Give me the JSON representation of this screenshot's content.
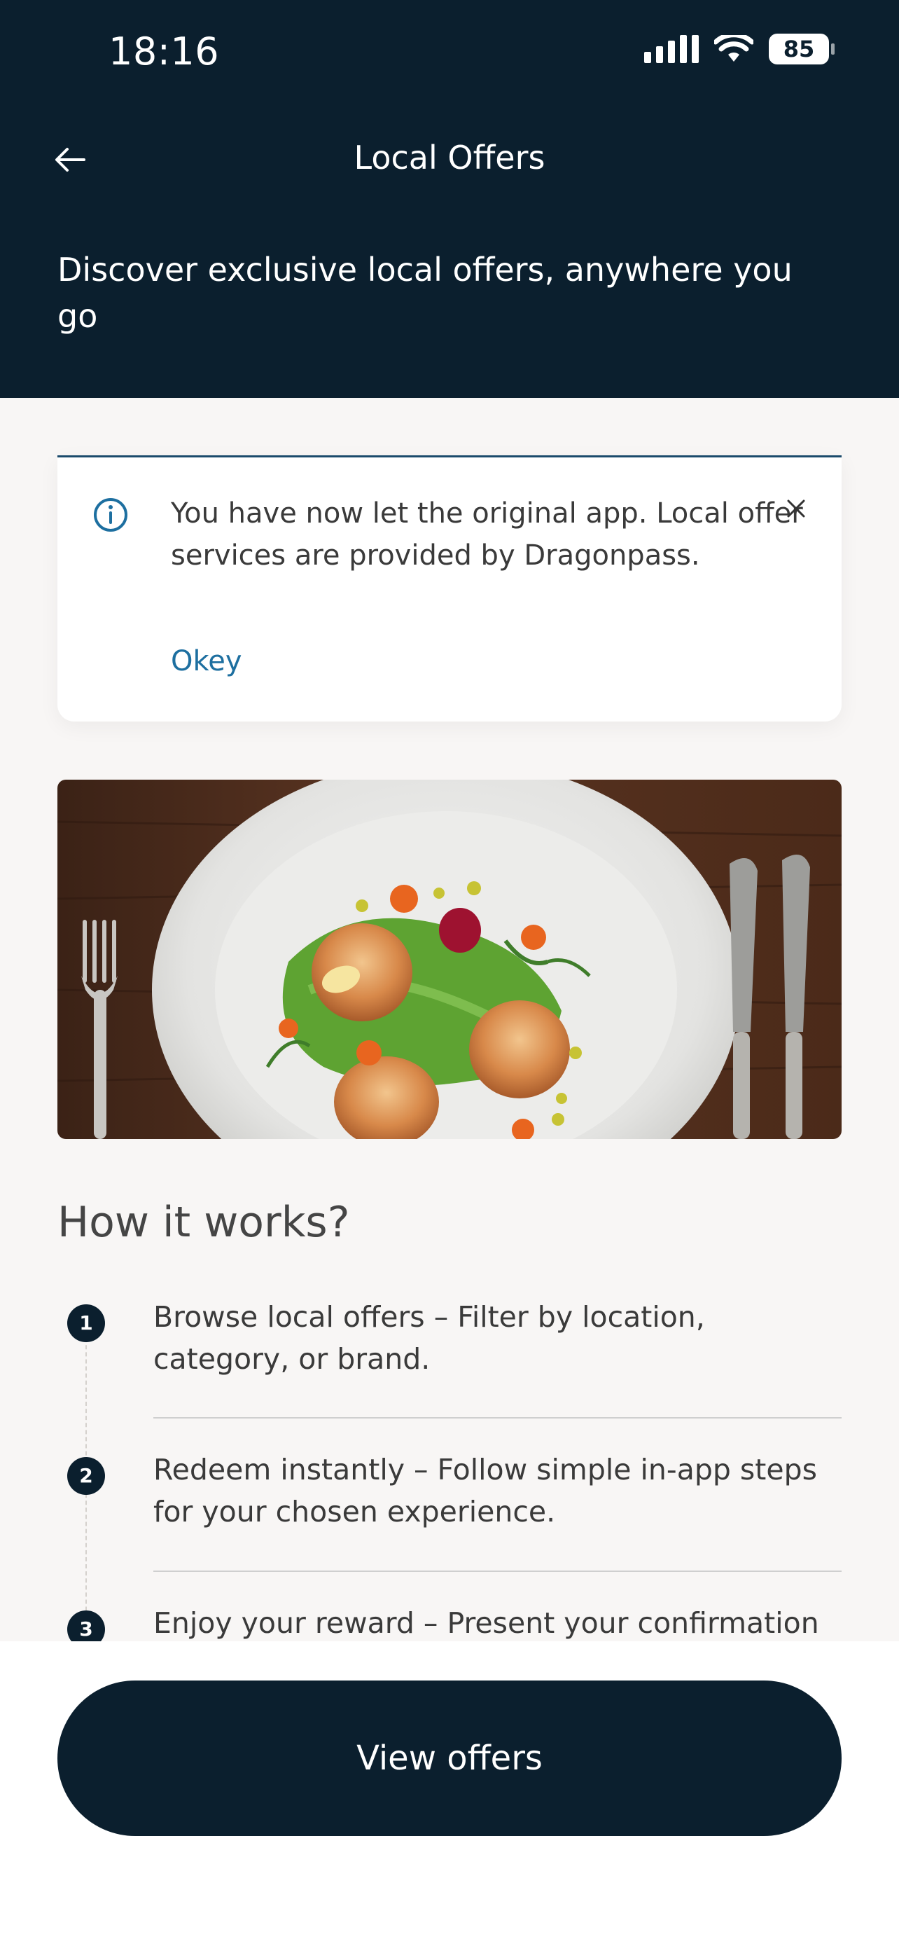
{
  "status_bar": {
    "time": "18:16",
    "battery": "85"
  },
  "header": {
    "title": "Local Offers",
    "subtitle": "Discover exclusive local offers, anywhere you go"
  },
  "notice": {
    "message": "You have now let the original app. Local offer services are provided by Dragonpass.",
    "action_label": "Okey"
  },
  "how_it_works": {
    "title": "How it works?",
    "steps": [
      {
        "number": "1",
        "text": "Browse local offers – Filter by location, category, or brand."
      },
      {
        "number": "2",
        "text": "Redeem instantly – Follow simple in-app steps for your chosen experience."
      },
      {
        "number": "3",
        "text": "Enjoy your reward – Present your confirmation"
      }
    ]
  },
  "cta": {
    "label": "View offers"
  },
  "colors": {
    "header_bg": "#0b1f2e",
    "accent": "#1d6fa0",
    "page_bg": "#f8f6f5"
  }
}
